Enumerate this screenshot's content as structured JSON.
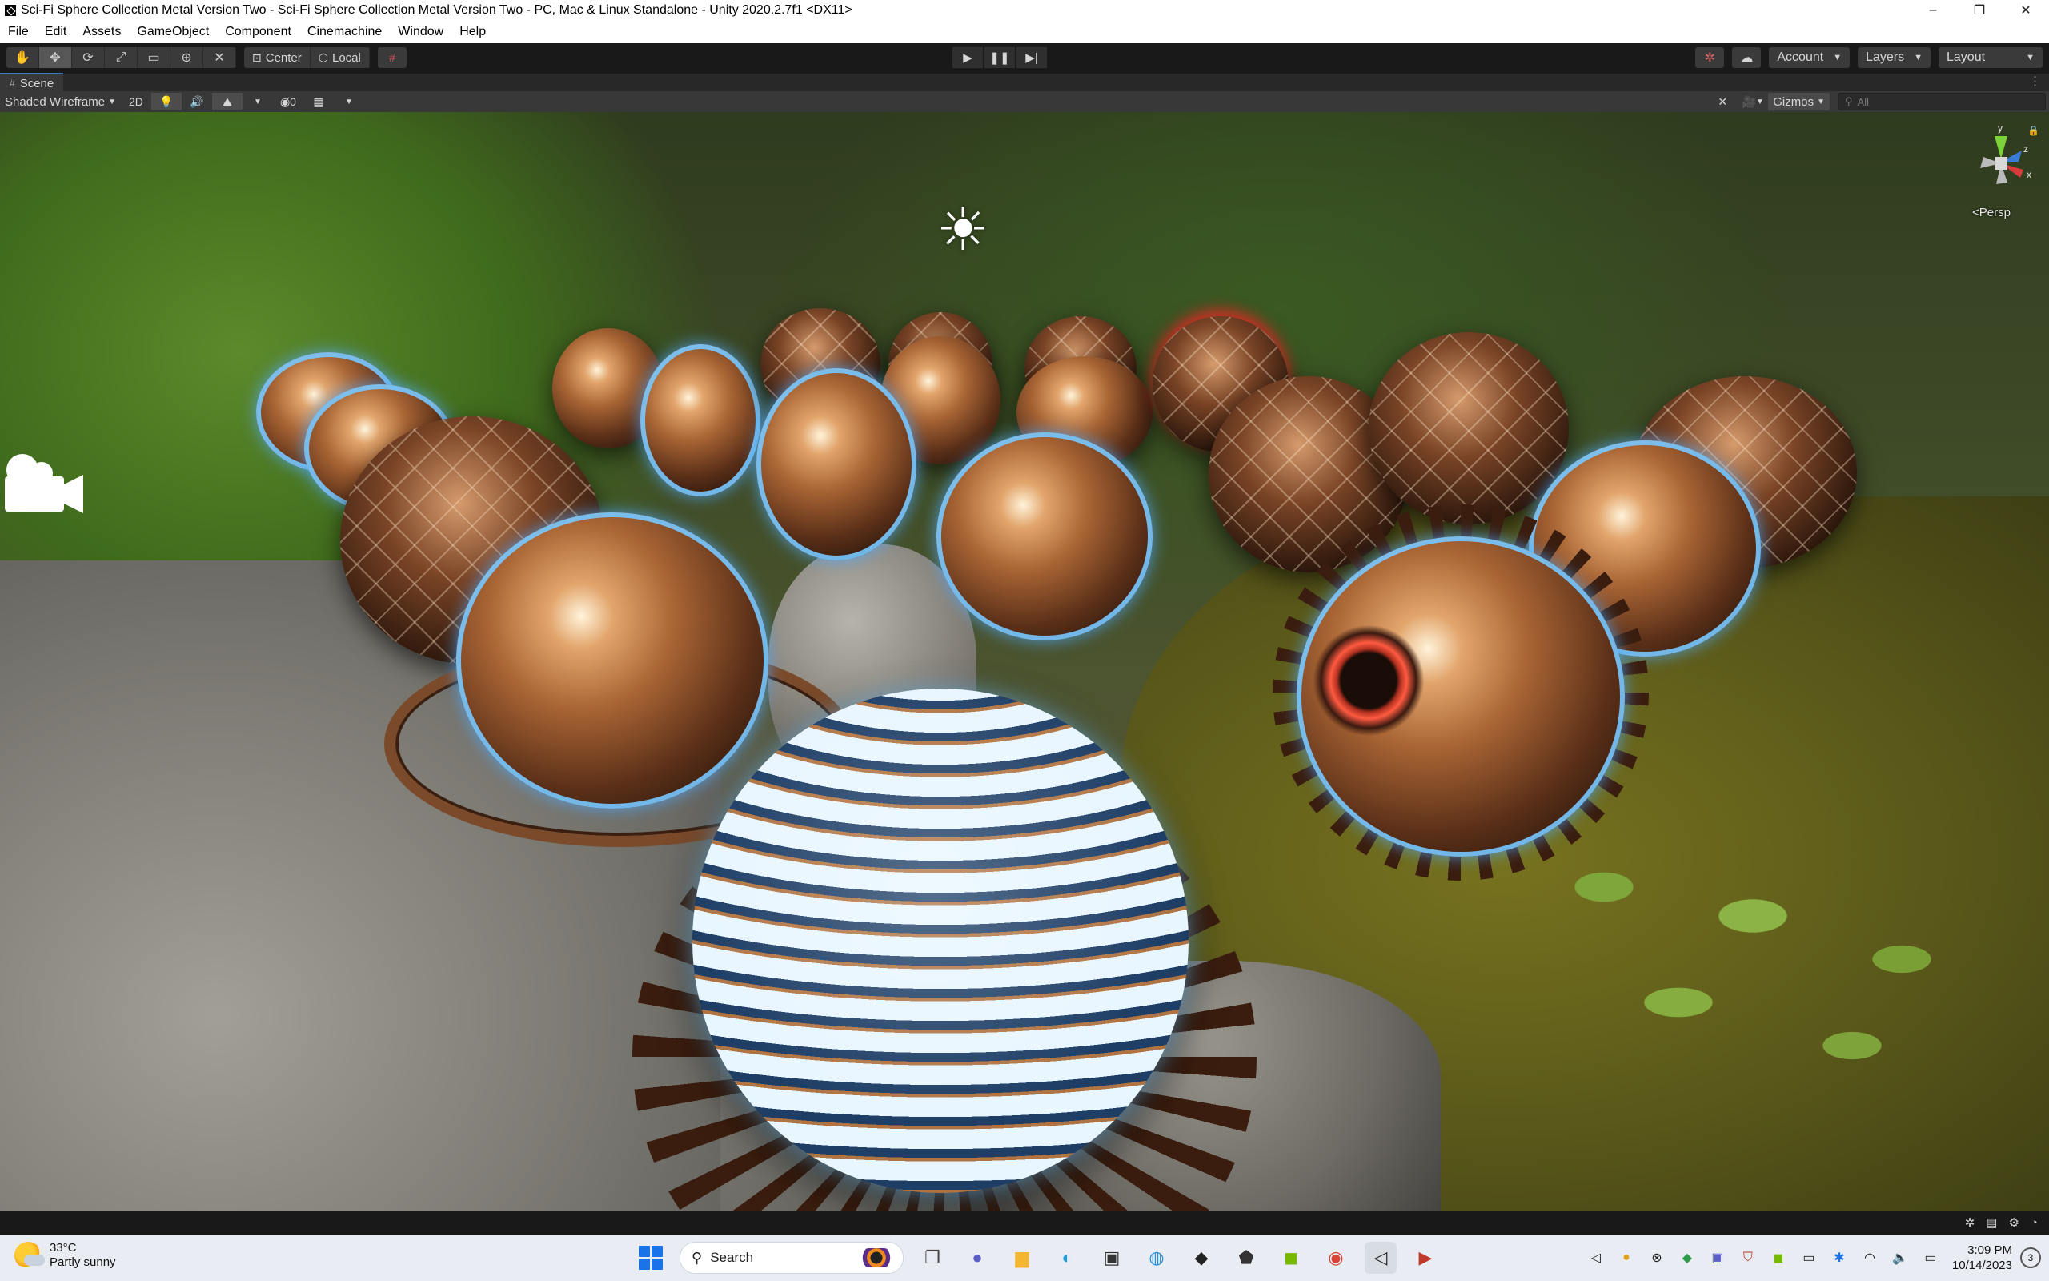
{
  "window": {
    "title": "Sci-Fi Sphere Collection Metal Version Two - Sci-Fi Sphere Collection Metal Version Two - PC, Mac & Linux Standalone - Unity 2020.2.7f1 <DX11>",
    "buttons": {
      "minimize": "–",
      "maximize": "❐",
      "close": "✕"
    }
  },
  "menu": {
    "items": [
      "File",
      "Edit",
      "Assets",
      "GameObject",
      "Component",
      "Cinemachine",
      "Window",
      "Help"
    ]
  },
  "toolbar": {
    "tools": [
      "hand-tool",
      "move-tool",
      "rotate-tool",
      "scale-tool",
      "rect-tool",
      "transform-tool",
      "custom-tool"
    ],
    "pivot_mode": "Center",
    "pivot_rotation": "Local",
    "account_label": "Account",
    "layers_label": "Layers",
    "layout_label": "Layout"
  },
  "scene_tab": {
    "label": "Scene"
  },
  "scene_toolbar": {
    "draw_mode": "Shaded Wireframe",
    "mode_2d": "2D",
    "hidden_count": "0",
    "gizmos_label": "Gizmos",
    "search_placeholder": "All"
  },
  "scene_view": {
    "persp_label": "<Persp",
    "gizmo_axes": {
      "y": "y",
      "z": "z",
      "x": "x"
    }
  },
  "taskbar": {
    "weather_temp": "33°C",
    "weather_desc": "Partly sunny",
    "search_label": "Search",
    "time": "3:09 PM",
    "date": "10/14/2023",
    "notifications": "3"
  },
  "colors": {
    "accent_blue": "#3a79bb",
    "unity_dark": "#191919",
    "taskbar_bg": "#e9edf3"
  }
}
